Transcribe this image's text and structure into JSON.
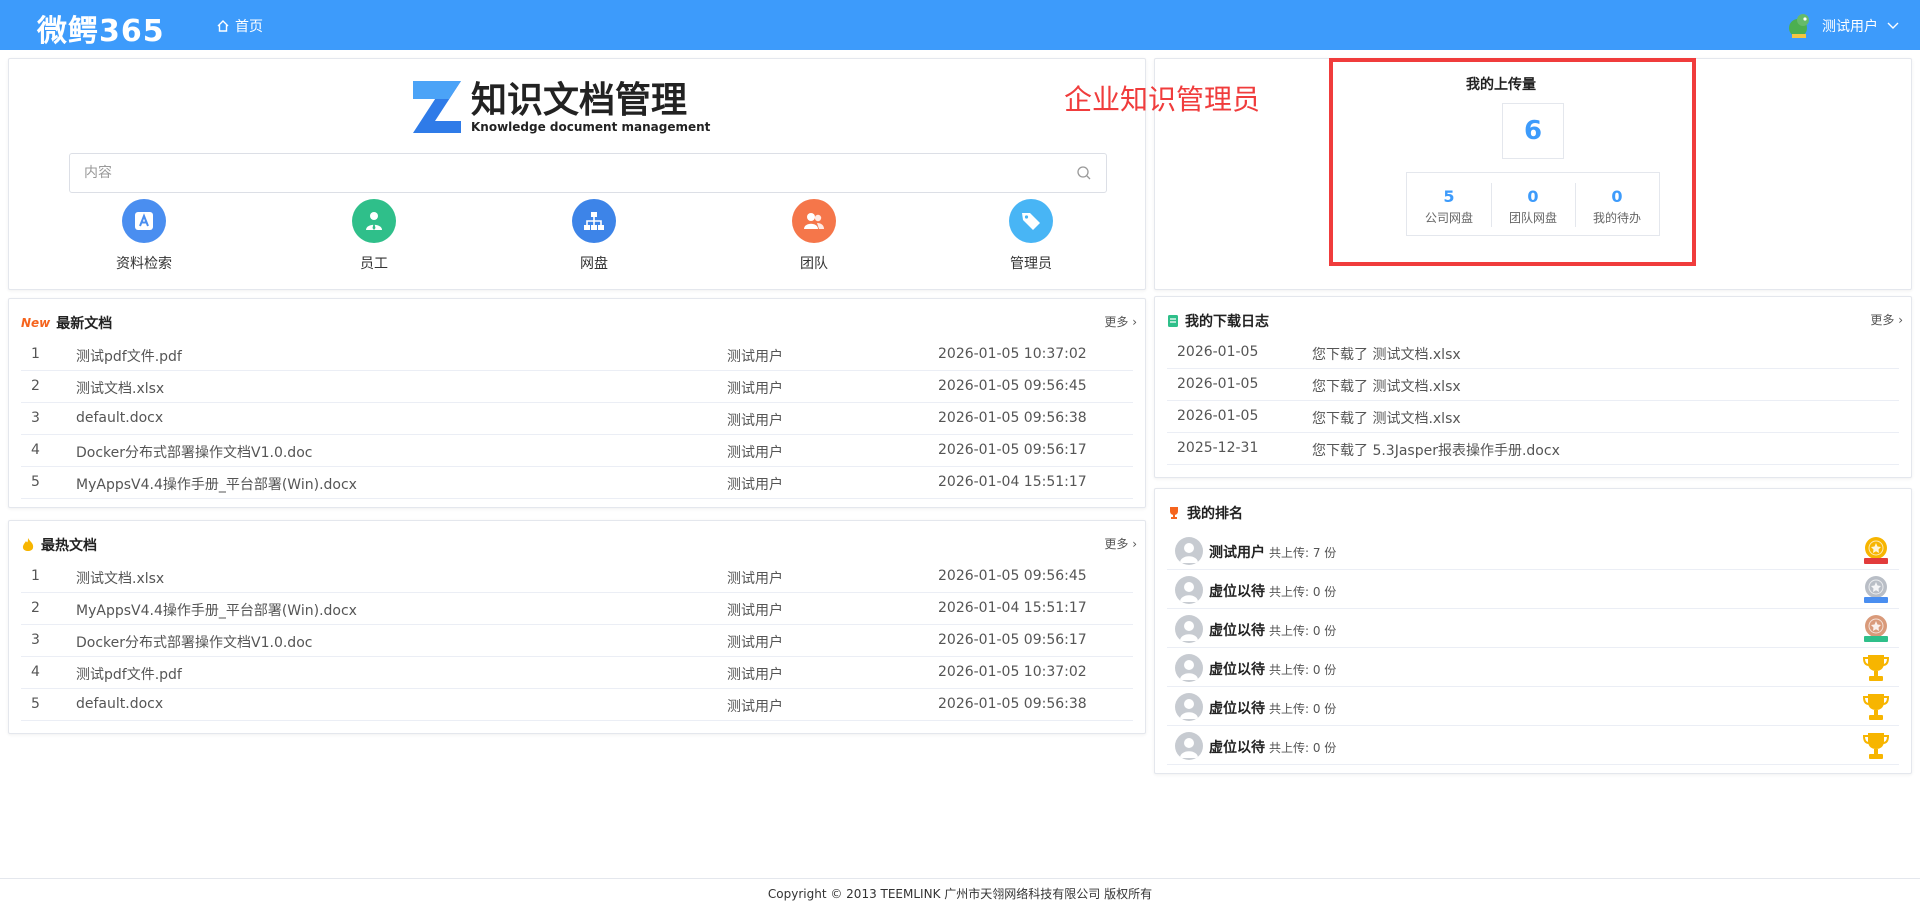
{
  "topbar": {
    "logo": "微鳄365",
    "home": "首页",
    "user": "测试用户"
  },
  "search": {
    "brand_title": "知识文档管理",
    "brand_subtitle": "Knowledge document management",
    "placeholder": "内容",
    "quick_links": [
      {
        "label": "资料检索",
        "icon": "search-docs-icon",
        "color": "#4a8ef0"
      },
      {
        "label": "员工",
        "icon": "employee-icon",
        "color": "#2fbf8a"
      },
      {
        "label": "网盘",
        "icon": "network-disk-icon",
        "color": "#3d84e8"
      },
      {
        "label": "团队",
        "icon": "team-icon",
        "color": "#f5764a"
      },
      {
        "label": "管理员",
        "icon": "admin-tag-icon",
        "color": "#48b5f5"
      }
    ]
  },
  "upload": {
    "annotation": "企业知识管理员",
    "title": "我的上传量",
    "count": "6",
    "stats": [
      {
        "num": "5",
        "label": "公司网盘"
      },
      {
        "num": "0",
        "label": "团队网盘"
      },
      {
        "num": "0",
        "label": "我的待办"
      }
    ]
  },
  "latest": {
    "badge": "New",
    "title": "最新文档",
    "more": "更多",
    "rows": [
      {
        "idx": "1",
        "name": "测试pdf文件.pdf",
        "user": "测试用户",
        "time": "2026-01-05 10:37:02"
      },
      {
        "idx": "2",
        "name": "测试文档.xlsx",
        "user": "测试用户",
        "time": "2026-01-05 09:56:45"
      },
      {
        "idx": "3",
        "name": "default.docx",
        "user": "测试用户",
        "time": "2026-01-05 09:56:38"
      },
      {
        "idx": "4",
        "name": "Docker分布式部署操作文档V1.0.doc",
        "user": "测试用户",
        "time": "2026-01-05 09:56:17"
      },
      {
        "idx": "5",
        "name": "MyAppsV4.4操作手册_平台部署(Win).docx",
        "user": "测试用户",
        "time": "2026-01-04 15:51:17"
      }
    ]
  },
  "hot": {
    "title": "最热文档",
    "more": "更多",
    "rows": [
      {
        "idx": "1",
        "name": "测试文档.xlsx",
        "user": "测试用户",
        "time": "2026-01-05 09:56:45"
      },
      {
        "idx": "2",
        "name": "MyAppsV4.4操作手册_平台部署(Win).docx",
        "user": "测试用户",
        "time": "2026-01-04 15:51:17"
      },
      {
        "idx": "3",
        "name": "Docker分布式部署操作文档V1.0.doc",
        "user": "测试用户",
        "time": "2026-01-05 09:56:17"
      },
      {
        "idx": "4",
        "name": "测试pdf文件.pdf",
        "user": "测试用户",
        "time": "2026-01-05 10:37:02"
      },
      {
        "idx": "5",
        "name": "default.docx",
        "user": "测试用户",
        "time": "2026-01-05 09:56:38"
      }
    ]
  },
  "download": {
    "title": "我的下载日志",
    "more": "更多",
    "rows": [
      {
        "date": "2026-01-05",
        "msg": "您下载了 测试文档.xlsx"
      },
      {
        "date": "2026-01-05",
        "msg": "您下载了 测试文档.xlsx"
      },
      {
        "date": "2026-01-05",
        "msg": "您下载了 测试文档.xlsx"
      },
      {
        "date": "2025-12-31",
        "msg": "您下载了 5.3Jasper报表操作手册.docx"
      }
    ]
  },
  "rank": {
    "title": "我的排名",
    "rows": [
      {
        "name": "测试用户",
        "count": "共上传: 7 份",
        "medal": "gold-medal-icon"
      },
      {
        "name": "虚位以待",
        "count": "共上传: 0 份",
        "medal": "silver-medal-icon"
      },
      {
        "name": "虚位以待",
        "count": "共上传: 0 份",
        "medal": "bronze-medal-icon"
      },
      {
        "name": "虚位以待",
        "count": "共上传: 0 份",
        "medal": "trophy-icon"
      },
      {
        "name": "虚位以待",
        "count": "共上传: 0 份",
        "medal": "trophy-icon"
      },
      {
        "name": "虚位以待",
        "count": "共上传: 0 份",
        "medal": "trophy-icon"
      }
    ]
  },
  "footer": "Copyright © 2013 TEEMLINK 广州市天翎网络科技有限公司 版权所有"
}
